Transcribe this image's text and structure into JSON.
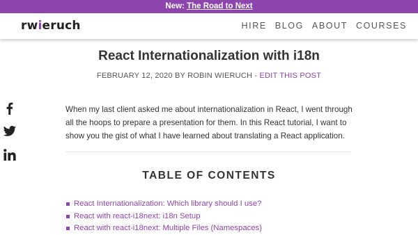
{
  "announcement": {
    "prefix": "New:",
    "link_text": "The Road to Next"
  },
  "header": {
    "logo_before": "rw",
    "logo_dot": "i",
    "logo_after": "eruch",
    "nav": [
      "HIRE",
      "BLOG",
      "ABOUT",
      "COURSES"
    ]
  },
  "article": {
    "title": "React Internationalization with i18n",
    "byline": "FEBRUARY 12, 2020 BY ROBIN WIERUCH",
    "byline_separator": " - ",
    "edit_link": "EDIT THIS POST",
    "intro": "When my last client asked me about internationalization in React, I went through all the hoops to prepare a presentation for them. In this React tutorial, I want to show you the gist of what I have learned about translating a React application."
  },
  "social": {
    "icons": [
      "facebook-icon",
      "twitter-icon",
      "linkedin-icon"
    ]
  },
  "toc": {
    "title": "TABLE OF CONTENTS",
    "items": [
      "React Internationalization: Which library should I use?",
      "React with react-i18next: i18n Setup",
      "React with react-i18next: Multiple Files (Namespaces)"
    ]
  },
  "colors": {
    "accent": "#8e44ad",
    "text": "#333333",
    "icon": "#222222"
  }
}
